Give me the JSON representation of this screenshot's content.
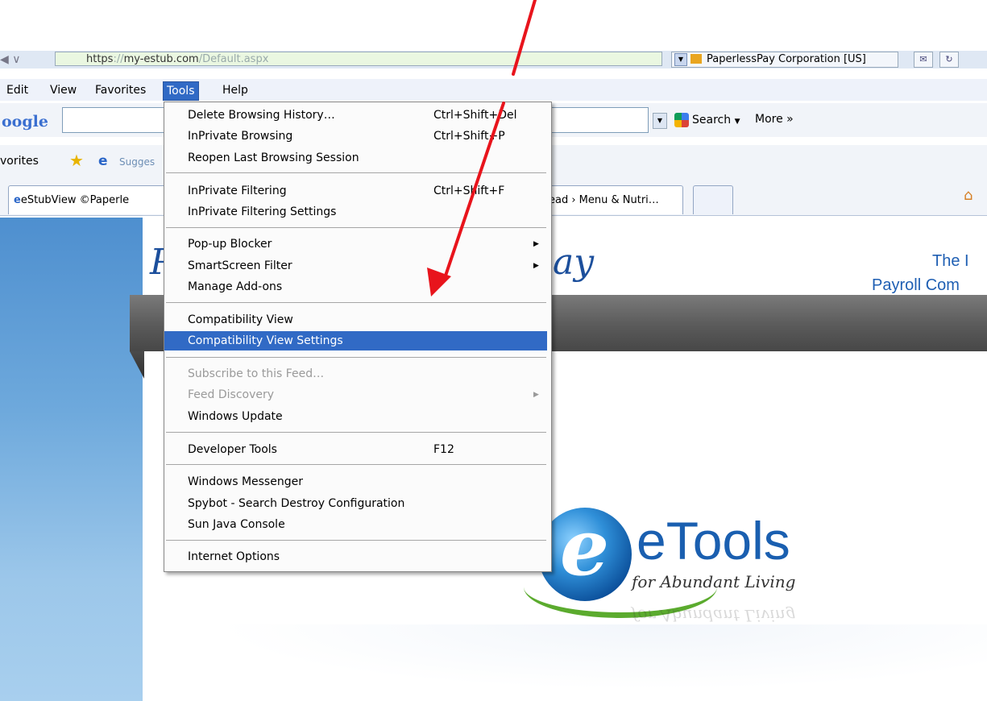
{
  "browser": {
    "address_secure": "https",
    "address_sep": "://",
    "address_host": "my-estub.com",
    "address_path": "/Default.aspx",
    "site_identity": "PaperlessPay Corporation [US]"
  },
  "menubar": {
    "items": [
      "Edit",
      "View",
      "Favorites",
      "Tools",
      "Help"
    ]
  },
  "google_toolbar": {
    "logo": "Google",
    "logo_visible": "oogle",
    "search_label": "Search",
    "more_label": "More »"
  },
  "favorites_bar": {
    "label": "vorites",
    "suggested": "Sugges"
  },
  "tabs": [
    {
      "label": "eStubView ©Paperle"
    },
    {
      "label": "ead › Menu & Nutri…"
    }
  ],
  "tools_menu": {
    "items": [
      {
        "label": "Delete Browsing History…",
        "shortcut": "Ctrl+Shift+Del"
      },
      {
        "label": "InPrivate Browsing",
        "shortcut": "Ctrl+Shift+P"
      },
      {
        "label": "Reopen Last Browsing Session",
        "shortcut": ""
      },
      {
        "label": "InPrivate Filtering",
        "shortcut": "Ctrl+Shift+F"
      },
      {
        "label": "InPrivate Filtering Settings",
        "shortcut": ""
      },
      {
        "label": "Pop-up Blocker",
        "shortcut": ""
      },
      {
        "label": "SmartScreen Filter",
        "shortcut": ""
      },
      {
        "label": "Manage Add-ons",
        "shortcut": ""
      },
      {
        "label": "Compatibility View",
        "shortcut": ""
      },
      {
        "label": "Compatibility View Settings",
        "shortcut": ""
      },
      {
        "label": "Subscribe to this Feed…",
        "shortcut": ""
      },
      {
        "label": "Feed Discovery",
        "shortcut": ""
      },
      {
        "label": "Windows Update",
        "shortcut": ""
      },
      {
        "label": "Developer Tools",
        "shortcut": "F12"
      },
      {
        "label": "Windows Messenger",
        "shortcut": ""
      },
      {
        "label": "Spybot - Search  Destroy Configuration",
        "shortcut": ""
      },
      {
        "label": "Sun Java Console",
        "shortcut": ""
      },
      {
        "label": "Internet Options",
        "shortcut": ""
      }
    ],
    "highlight_color": "#316ac5"
  },
  "page": {
    "brand_partial_left": "P",
    "brand_partial_right": "ay",
    "tagline_line1": "The I",
    "tagline_line2": "Payroll Com",
    "etools_word": "eTools",
    "etools_sub": "for Abundant Living"
  },
  "annotation": {
    "arrow_color": "#e8141c"
  }
}
